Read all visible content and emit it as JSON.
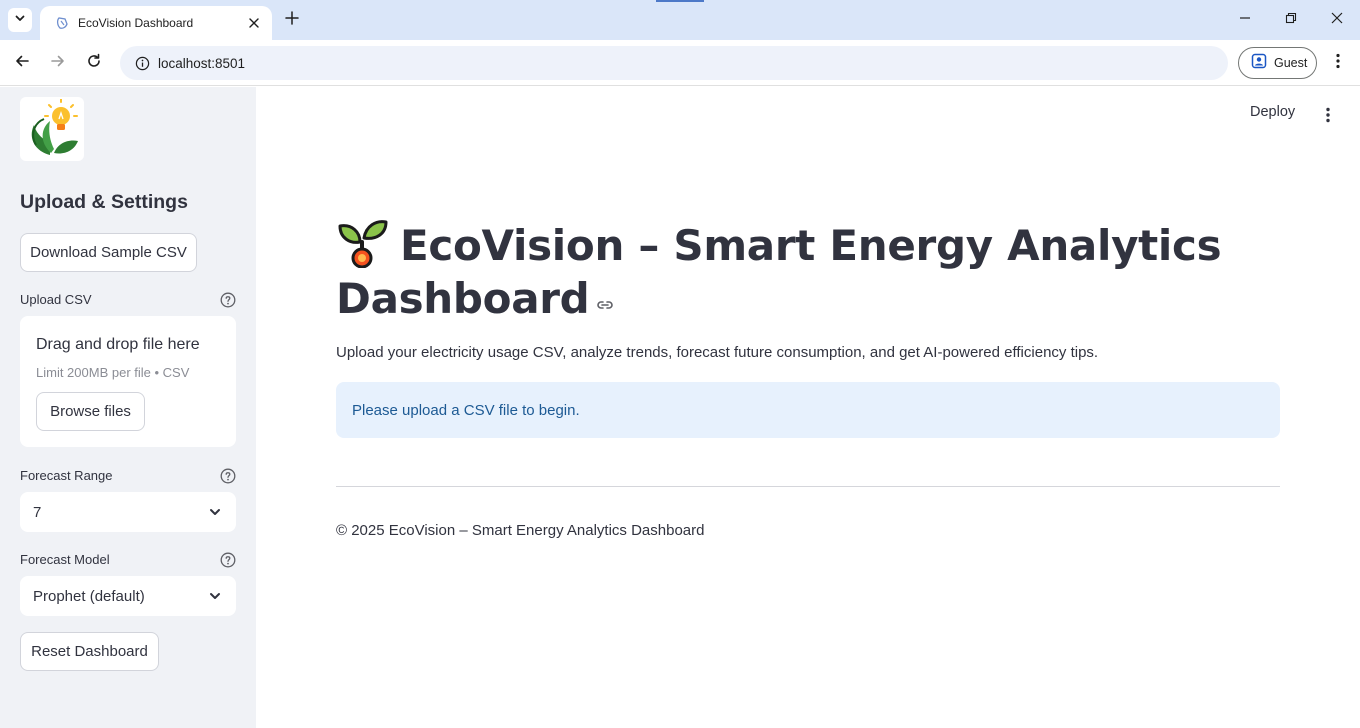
{
  "browser": {
    "tab_title": "EcoVision Dashboard",
    "url": "localhost:8501",
    "profile_label": "Guest"
  },
  "sidebar": {
    "heading": "Upload & Settings",
    "download_button": "Download Sample CSV",
    "upload": {
      "label": "Upload CSV",
      "drop_text": "Drag and drop file here",
      "limit_text": "Limit 200MB per file • CSV",
      "browse_button": "Browse files"
    },
    "forecast_range": {
      "label": "Forecast Range",
      "value": "7"
    },
    "forecast_model": {
      "label": "Forecast Model",
      "value": "Prophet (default)"
    },
    "reset_button": "Reset Dashboard"
  },
  "main": {
    "deploy_label": "Deploy",
    "title": "EcoVision – Smart Energy Analytics Dashboard",
    "subtitle": "Upload your electricity usage CSV, analyze trends, forecast future consumption, and get AI-powered efficiency tips.",
    "info_message": "Please upload a CSV file to begin.",
    "footer": "© 2025 EcoVision – Smart Energy Analytics Dashboard"
  },
  "icons": {
    "tab_search": "chevron-down-icon",
    "favicon": "streamlit-icon",
    "title_emoji": "seedling-icon",
    "anchor": "link-icon"
  },
  "colors": {
    "sidebar_bg": "#f0f2f6",
    "info_bg": "#e7f1fd",
    "info_text": "#1d5a94",
    "tabbar_bg": "#dae6f9"
  }
}
